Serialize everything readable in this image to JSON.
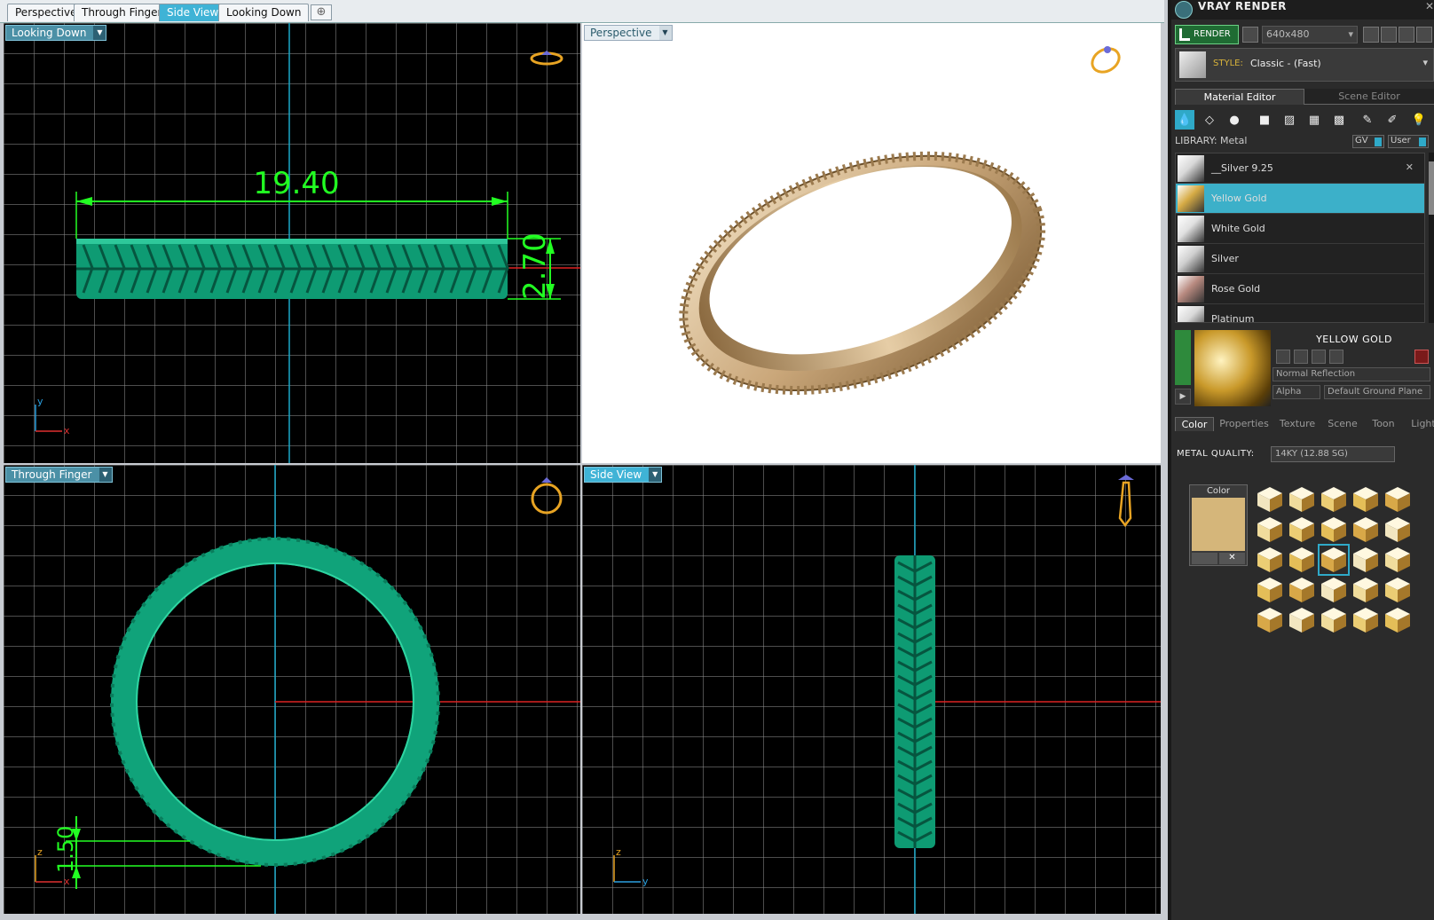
{
  "tabs": [
    {
      "label": "Perspective",
      "active": false
    },
    {
      "label": "Through Finger",
      "active": false
    },
    {
      "label": "Side View",
      "active": true
    },
    {
      "label": "Looking Down",
      "active": false
    }
  ],
  "add_tab_icon": "plus-icon",
  "viewports": {
    "top_left": {
      "label": "Looking Down",
      "width_dim": "19.40",
      "height_dim": "2.70",
      "axis_v": "y",
      "axis_h": "x"
    },
    "top_right": {
      "label": "Perspective"
    },
    "bottom_left": {
      "label": "Through Finger",
      "thickness_dim": "1.50",
      "axis_v": "z",
      "axis_h": "x"
    },
    "bottom_right": {
      "label": "Side View",
      "axis_v": "z",
      "axis_h": "y"
    }
  },
  "panel": {
    "title": "VRAY RENDER",
    "close": "✕",
    "render_label": "RENDER",
    "resolution": "640x480",
    "style_label": "STYLE:",
    "style_value": "Classic - (Fast)",
    "editor_tabs": [
      "Material Editor",
      "Scene Editor"
    ],
    "library_label": "LIBRARY: Metal",
    "gv_label": "GV",
    "user_label": "User",
    "materials": [
      {
        "name": "__Silver 9.25",
        "selected": false,
        "removable": true,
        "swatch": "#d8d8d8"
      },
      {
        "name": "Yellow Gold",
        "selected": true,
        "removable": false,
        "swatch": "#d6ab45"
      },
      {
        "name": "White Gold",
        "selected": false,
        "removable": false,
        "swatch": "#e0e0e0"
      },
      {
        "name": "Silver",
        "selected": false,
        "removable": false,
        "swatch": "#cfcfcf"
      },
      {
        "name": "Rose Gold",
        "selected": false,
        "removable": false,
        "swatch": "#b88a80"
      },
      {
        "name": "Platinum",
        "selected": false,
        "removable": false,
        "swatch": "#d8d8d8"
      }
    ],
    "material_name": "YELLOW GOLD",
    "reflection": "Normal Reflection",
    "alpha_label": "Alpha",
    "ground_plane": "Default Ground Plane",
    "sub_tabs": [
      "Color",
      "Properties",
      "Texture",
      "Scene",
      "Toon",
      "Light"
    ],
    "quality_label": "METAL QUALITY:",
    "quality_value": "14KY        (12.88 SG)",
    "color_label": "Color",
    "color_value": "#d5b67a",
    "clear_icon": "✕"
  }
}
